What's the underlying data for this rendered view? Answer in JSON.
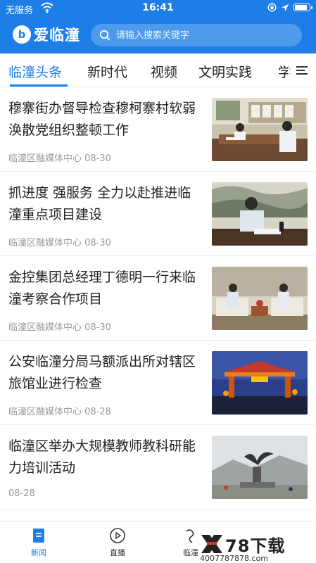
{
  "status_bar": {
    "carrier": "无服务",
    "time": "16:41",
    "battery_level": 0.9
  },
  "header": {
    "app_name": "爱临潼",
    "logo_glyph": "b",
    "search_placeholder": "请输入搜索关键字"
  },
  "tabs": [
    {
      "label": "临潼头条",
      "active": true
    },
    {
      "label": "新时代",
      "active": false
    },
    {
      "label": "视频",
      "active": false
    },
    {
      "label": "文明实践",
      "active": false
    },
    {
      "label": "学",
      "active": false
    }
  ],
  "news": [
    {
      "title": "穆寨街办督导检查穆柯寨村软弱涣散党组织整顿工作",
      "source": "临潼区融媒体中心",
      "date": "08-30",
      "image": "meeting-room-photo"
    },
    {
      "title": "抓进度 强服务 全力以赴推进临潼重点项目建设",
      "source": "临潼区融媒体中心",
      "date": "08-30",
      "image": "official-desk-photo"
    },
    {
      "title": "金控集团总经理丁德明一行来临潼考察合作项目",
      "source": "临潼区融媒体中心",
      "date": "08-30",
      "image": "sofa-meeting-photo"
    },
    {
      "title": "公安临潼分局马额派出所对辖区旅馆业进行检查",
      "source": "临潼区融媒体中心",
      "date": "08-28",
      "image": "night-gate-photo"
    },
    {
      "title": "临潼区举办大规模教师教科研能力培训活动",
      "source": "",
      "date": "08-28",
      "image": "sculpture-photo"
    }
  ],
  "bottom_nav": [
    {
      "label": "新闻",
      "icon": "news-doc-icon",
      "active": true
    },
    {
      "label": "直播",
      "icon": "play-circle-icon",
      "active": false
    },
    {
      "label": "临潼",
      "icon": "lintong-icon",
      "active": false
    }
  ],
  "watermark": {
    "title": "78下载",
    "url": "4007787878.com"
  },
  "colors": {
    "brand": "#1d7ee8",
    "meta_text": "#999999",
    "title_text": "#222222"
  }
}
